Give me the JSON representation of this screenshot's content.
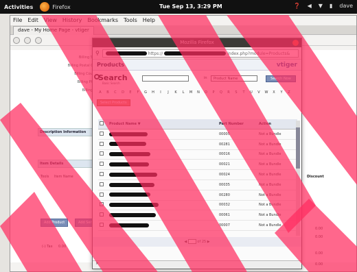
{
  "topbar": {
    "activities": "Activities",
    "app": "Firefox",
    "clock": "Tue Sep 13, 3:29 PM",
    "user": "dave"
  },
  "bg_window": {
    "menu": [
      "File",
      "Edit",
      "View",
      "History",
      "Bookmarks",
      "Tools",
      "Help"
    ],
    "tab_label": "dave - My Home Page - vtiger",
    "fields": [
      "Billing State",
      "Billing Postal Code",
      "Billing Country",
      "Billing Phone",
      "Billing Fax"
    ],
    "description_section": "Description Information",
    "item_details": "Item Details",
    "item_cols": [
      "Tools",
      "Item Name"
    ],
    "buttons": [
      "Add Product",
      "Add Service"
    ],
    "right_values": [
      "0.00",
      "0.00",
      "0.00",
      "0.00"
    ],
    "list_price_label": "Discount",
    "tax_label": "(-) Tax",
    "tax_value": "0.00"
  },
  "popup": {
    "title": "Mozilla Firefox",
    "url_prefix": "https://",
    "url_suffix": "index.php?module=Products&",
    "products_title": "Products",
    "brand": "vtiger",
    "search_label": "Search",
    "search_sub": "Basic Search",
    "search_in": "in",
    "search_field_option": "Product Name",
    "search_now": "Search Now",
    "alphabet": [
      "A",
      "B",
      "C",
      "D",
      "E",
      "F",
      "G",
      "H",
      "I",
      "J",
      "K",
      "L",
      "M",
      "N",
      "O",
      "P",
      "Q",
      "R",
      "S",
      "T",
      "U",
      "V",
      "W",
      "X",
      "Y",
      "Z"
    ],
    "select_products": "Select Products",
    "columns": [
      "Product Name",
      "Part Number",
      "Action"
    ],
    "rows": [
      {
        "part": "00005",
        "action": "Not a Bundle"
      },
      {
        "part": "00281",
        "action": "Not a Bundle"
      },
      {
        "part": "00016",
        "action": "Not a Bundle"
      },
      {
        "part": "00021",
        "action": "Not a Bundle"
      },
      {
        "part": "00024",
        "action": "Not a Bundle"
      },
      {
        "part": "00035",
        "action": "Not a Bundle"
      },
      {
        "part": "00280",
        "action": "Not a Bundle"
      },
      {
        "part": "00032",
        "action": "Not a Bundle"
      },
      {
        "part": "00061",
        "action": "Not a Bundle"
      },
      {
        "part": "00007",
        "action": "Not a Bundle"
      }
    ],
    "pager_of": "of 25"
  },
  "colors": {
    "overlay": "#ff2d5f",
    "accent": "#7a8fb8"
  }
}
